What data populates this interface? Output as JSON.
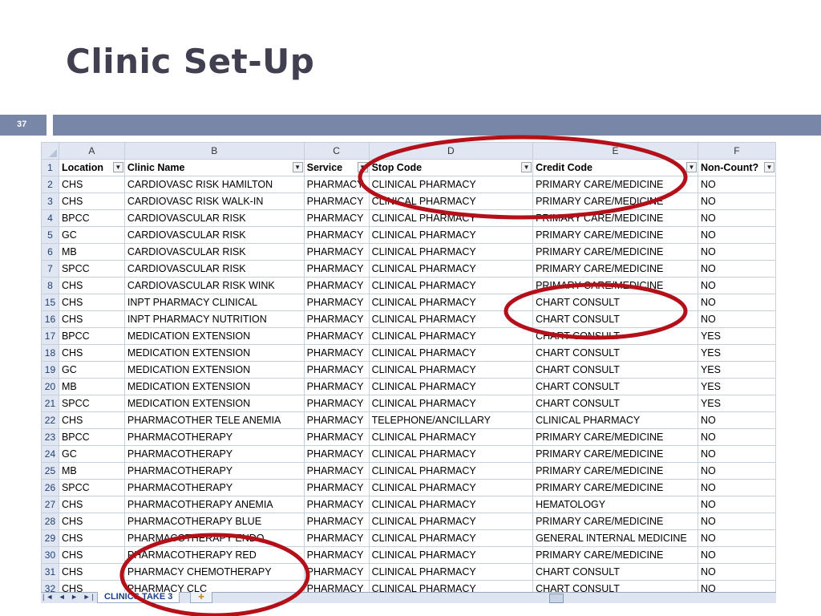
{
  "slide": {
    "title": "Clinic Set-Up",
    "number": "37"
  },
  "spreadsheet": {
    "column_letters": [
      "A",
      "B",
      "C",
      "D",
      "E",
      "F"
    ],
    "headers": [
      "Location",
      "Clinic Name",
      "Service",
      "Stop Code",
      "Credit Code",
      "Non-Count?"
    ],
    "header_row_number": "1",
    "rows": [
      {
        "n": "2",
        "cells": [
          "CHS",
          "CARDIOVASC RISK HAMILTON",
          "PHARMACY",
          "CLINICAL PHARMACY",
          "PRIMARY CARE/MEDICINE",
          "NO"
        ]
      },
      {
        "n": "3",
        "cells": [
          "CHS",
          "CARDIOVASC RISK WALK-IN",
          "PHARMACY",
          "CLINICAL PHARMACY",
          "PRIMARY CARE/MEDICINE",
          "NO"
        ]
      },
      {
        "n": "4",
        "cells": [
          "BPCC",
          "CARDIOVASCULAR RISK",
          "PHARMACY",
          "CLINICAL PHARMACY",
          "PRIMARY CARE/MEDICINE",
          "NO"
        ]
      },
      {
        "n": "5",
        "cells": [
          "GC",
          "CARDIOVASCULAR RISK",
          "PHARMACY",
          "CLINICAL PHARMACY",
          "PRIMARY CARE/MEDICINE",
          "NO"
        ]
      },
      {
        "n": "6",
        "cells": [
          "MB",
          "CARDIOVASCULAR RISK",
          "PHARMACY",
          "CLINICAL PHARMACY",
          "PRIMARY CARE/MEDICINE",
          "NO"
        ]
      },
      {
        "n": "7",
        "cells": [
          "SPCC",
          "CARDIOVASCULAR RISK",
          "PHARMACY",
          "CLINICAL PHARMACY",
          "PRIMARY CARE/MEDICINE",
          "NO"
        ]
      },
      {
        "n": "8",
        "cells": [
          "CHS",
          "CARDIOVASCULAR RISK WINK",
          "PHARMACY",
          "CLINICAL PHARMACY",
          "PRIMARY CARE/MEDICINE",
          "NO"
        ]
      },
      {
        "n": "15",
        "cells": [
          "CHS",
          "INPT PHARMACY CLINICAL",
          "PHARMACY",
          "CLINICAL PHARMACY",
          "CHART CONSULT",
          "NO"
        ]
      },
      {
        "n": "16",
        "cells": [
          "CHS",
          "INPT PHARMACY NUTRITION",
          "PHARMACY",
          "CLINICAL PHARMACY",
          "CHART CONSULT",
          "NO"
        ]
      },
      {
        "n": "17",
        "cells": [
          "BPCC",
          "MEDICATION EXTENSION",
          "PHARMACY",
          "CLINICAL PHARMACY",
          "CHART CONSULT",
          "YES"
        ]
      },
      {
        "n": "18",
        "cells": [
          "CHS",
          "MEDICATION EXTENSION",
          "PHARMACY",
          "CLINICAL PHARMACY",
          "CHART CONSULT",
          "YES"
        ]
      },
      {
        "n": "19",
        "cells": [
          "GC",
          "MEDICATION EXTENSION",
          "PHARMACY",
          "CLINICAL PHARMACY",
          "CHART CONSULT",
          "YES"
        ]
      },
      {
        "n": "20",
        "cells": [
          "MB",
          "MEDICATION EXTENSION",
          "PHARMACY",
          "CLINICAL PHARMACY",
          "CHART CONSULT",
          "YES"
        ]
      },
      {
        "n": "21",
        "cells": [
          "SPCC",
          "MEDICATION EXTENSION",
          "PHARMACY",
          "CLINICAL PHARMACY",
          "CHART CONSULT",
          "YES"
        ]
      },
      {
        "n": "22",
        "cells": [
          "CHS",
          "PHARMACOTHER TELE ANEMIA",
          "PHARMACY",
          "TELEPHONE/ANCILLARY",
          "CLINICAL PHARMACY",
          "NO"
        ]
      },
      {
        "n": "23",
        "cells": [
          "BPCC",
          "PHARMACOTHERAPY",
          "PHARMACY",
          "CLINICAL PHARMACY",
          "PRIMARY CARE/MEDICINE",
          "NO"
        ]
      },
      {
        "n": "24",
        "cells": [
          "GC",
          "PHARMACOTHERAPY",
          "PHARMACY",
          "CLINICAL PHARMACY",
          "PRIMARY CARE/MEDICINE",
          "NO"
        ]
      },
      {
        "n": "25",
        "cells": [
          "MB",
          "PHARMACOTHERAPY",
          "PHARMACY",
          "CLINICAL PHARMACY",
          "PRIMARY CARE/MEDICINE",
          "NO"
        ]
      },
      {
        "n": "26",
        "cells": [
          "SPCC",
          "PHARMACOTHERAPY",
          "PHARMACY",
          "CLINICAL PHARMACY",
          "PRIMARY CARE/MEDICINE",
          "NO"
        ]
      },
      {
        "n": "27",
        "cells": [
          "CHS",
          "PHARMACOTHERAPY ANEMIA",
          "PHARMACY",
          "CLINICAL PHARMACY",
          "HEMATOLOGY",
          "NO"
        ]
      },
      {
        "n": "28",
        "cells": [
          "CHS",
          "PHARMACOTHERAPY BLUE",
          "PHARMACY",
          "CLINICAL PHARMACY",
          "PRIMARY CARE/MEDICINE",
          "NO"
        ]
      },
      {
        "n": "29",
        "cells": [
          "CHS",
          "PHARMACOTHERAPY ENDO",
          "PHARMACY",
          "CLINICAL PHARMACY",
          "GENERAL INTERNAL MEDICINE",
          "NO"
        ]
      },
      {
        "n": "30",
        "cells": [
          "CHS",
          "PHARMACOTHERAPY RED",
          "PHARMACY",
          "CLINICAL PHARMACY",
          "PRIMARY CARE/MEDICINE",
          "NO"
        ]
      },
      {
        "n": "31",
        "cells": [
          "CHS",
          "PHARMACY CHEMOTHERAPY",
          "PHARMACY",
          "CLINICAL PHARMACY",
          "CHART CONSULT",
          "NO"
        ]
      },
      {
        "n": "32",
        "cells": [
          "CHS",
          "PHARMACY CLC",
          "PHARMACY",
          "CLINICAL PHARMACY",
          "CHART CONSULT",
          "NO"
        ]
      }
    ],
    "sheet_tab": "CLINICS TAKE 3",
    "icons": [
      "select-all-corner-icon",
      "filter-dropdown-icon",
      "sheet-nav-arrows-icon",
      "insert-sheet-icon"
    ]
  },
  "colors": {
    "title_text": "#404050",
    "title_bar": "#7886a7",
    "header_fill": "#e1e7f2",
    "gridline": "#c6cfdc",
    "highlight_ellipse": "#b3101a"
  }
}
